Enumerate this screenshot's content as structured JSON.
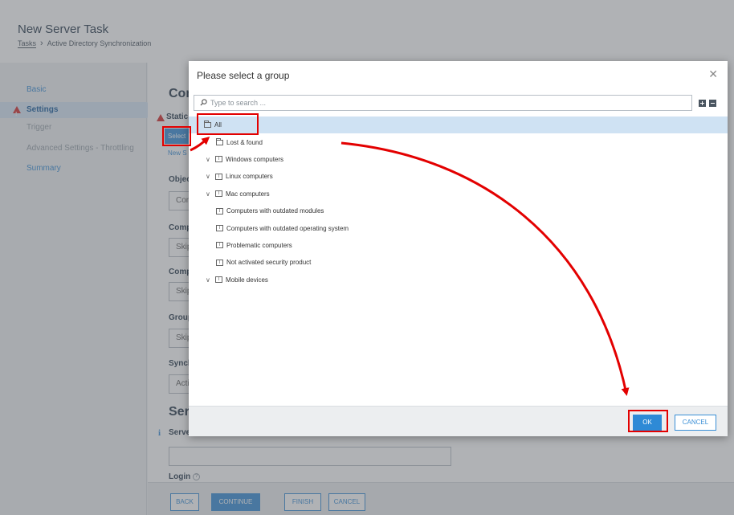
{
  "header": {
    "title": "New Server Task",
    "breadcrumb": [
      "Tasks",
      "Active Directory Synchronization"
    ]
  },
  "sidebar": {
    "items": [
      {
        "label": "Basic",
        "state": "normal"
      },
      {
        "label": "Settings",
        "state": "active"
      },
      {
        "label": "Trigger",
        "state": "disabled"
      },
      {
        "label": "Advanced Settings - Throttling",
        "state": "disabled"
      },
      {
        "label": "Summary",
        "state": "normal"
      }
    ]
  },
  "content": {
    "section1_title": "Con",
    "static_label": "Static",
    "select_label": "Select",
    "new_link": "New S",
    "object_label": "Objec",
    "object_value": "Con",
    "comp1_label": "Comp",
    "comp1_value": "Skip",
    "comp2_label": "Comp",
    "comp2_value": "Skip",
    "group_label": "Group",
    "group_value": "Skip",
    "sync_label": "Synch",
    "sync_value": "Acti",
    "section2_title": "Serv",
    "server_label": "Server",
    "login_label": "Login"
  },
  "footer": {
    "back": "BACK",
    "continue": "CONTINUE",
    "finish": "FINISH",
    "cancel": "CANCEL"
  },
  "dialog": {
    "title": "Please select a group",
    "close_icon": "close-icon",
    "search_placeholder": "Type to search ...",
    "tree": [
      {
        "label": "All",
        "level": 0,
        "icon": "folder",
        "chevron": false,
        "selected": true
      },
      {
        "label": "Lost & found",
        "level": 1,
        "icon": "folder",
        "chevron": false,
        "selected": false
      },
      {
        "label": "Windows computers",
        "level": 1,
        "icon": "dynamic-group",
        "chevron": true,
        "selected": false
      },
      {
        "label": "Linux computers",
        "level": 1,
        "icon": "dynamic-group",
        "chevron": true,
        "selected": false
      },
      {
        "label": "Mac computers",
        "level": 1,
        "icon": "dynamic-group",
        "chevron": true,
        "selected": false
      },
      {
        "label": "Computers with outdated modules",
        "level": 2,
        "icon": "dynamic-group",
        "chevron": false,
        "selected": false
      },
      {
        "label": "Computers with outdated operating system",
        "level": 2,
        "icon": "dynamic-group",
        "chevron": false,
        "selected": false
      },
      {
        "label": "Problematic computers",
        "level": 2,
        "icon": "dynamic-group",
        "chevron": false,
        "selected": false
      },
      {
        "label": "Not activated security product",
        "level": 2,
        "icon": "dynamic-group",
        "chevron": false,
        "selected": false
      },
      {
        "label": "Mobile devices",
        "level": 1,
        "icon": "dynamic-group",
        "chevron": true,
        "selected": false
      }
    ],
    "ok_label": "OK",
    "cancel_label": "CANCEL"
  },
  "colors": {
    "accent": "#3a8fd6",
    "selected_row": "#cfe2f3",
    "annotation": "#e30000",
    "warning": "#d32f2f"
  }
}
